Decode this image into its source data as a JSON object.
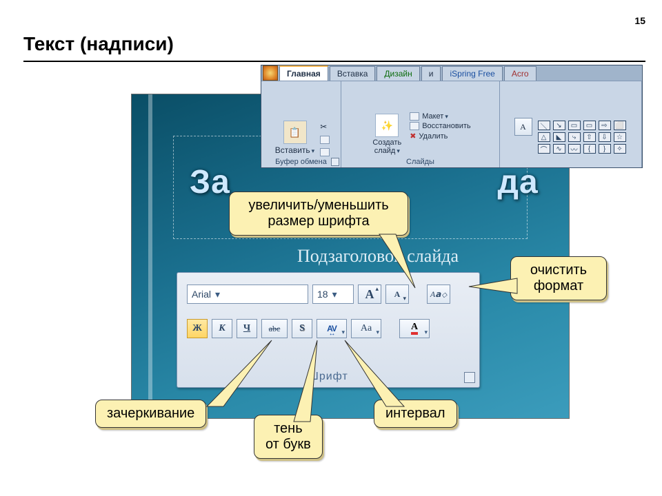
{
  "page_number": "15",
  "page_title": "Текст (надписи)",
  "slide": {
    "title": "Заголовок слайда",
    "title_visible_left": "За",
    "title_visible_right": "да",
    "subtitle": "Подзаголовок слайда"
  },
  "ribbon": {
    "tabs": [
      "Главная",
      "Вставка",
      "Дизайн",
      "и",
      "iSpring Free",
      "Acro"
    ],
    "groups": {
      "clipboard": {
        "paste": "Вставить",
        "label": "Буфер обмена"
      },
      "slides": {
        "new_slide": "Создать\nслайд",
        "layout": "Макет",
        "reset": "Восстановить",
        "delete": "Удалить",
        "label": "Слайды"
      }
    }
  },
  "font_panel": {
    "font_name": "Arial",
    "font_size": "18",
    "footer": "Шрифт"
  },
  "callouts": {
    "size": "увеличить/уменьшить\nразмер шрифта",
    "clear": "очистить\nформат",
    "strike": "зачеркивание",
    "shadow": "тень\nот букв",
    "spacing": "интервал"
  }
}
